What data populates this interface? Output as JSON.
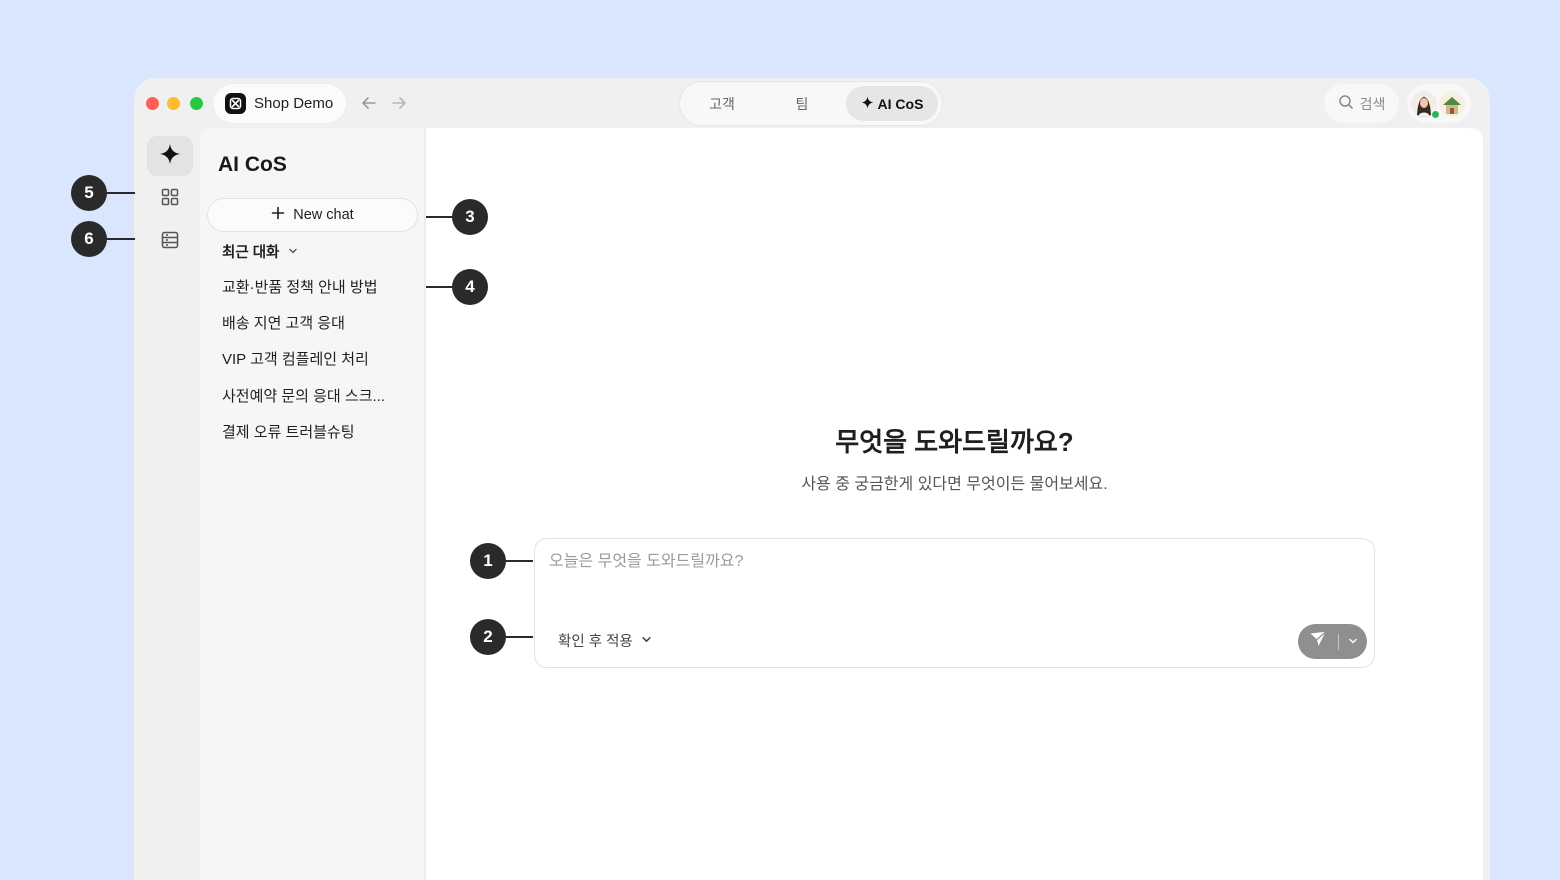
{
  "window": {
    "app_name": "Shop Demo",
    "tabs": [
      {
        "label": "고객",
        "active": false
      },
      {
        "label": "팀",
        "active": false
      },
      {
        "label": "AI CoS",
        "active": true,
        "icon": "sparkle-icon"
      }
    ],
    "search_label": "검색"
  },
  "rail": {
    "items": [
      {
        "icon": "sparkle-icon",
        "active": true
      },
      {
        "icon": "grid-icon",
        "active": false
      },
      {
        "icon": "list-icon",
        "active": false
      }
    ]
  },
  "sidebar": {
    "title": "AI CoS",
    "new_chat_label": "New chat",
    "section_label": "최근 대화",
    "chats": [
      "교환·반품 정책 안내 방법",
      "배송 지연 고객 응대",
      "VIP 고객 컴플레인 처리",
      "사전예약 문의 응대 스크...",
      "결제 오류 트러블슈팅"
    ]
  },
  "main": {
    "heading": "무엇을 도와드릴까요?",
    "subheading": "사용 중 궁금한게 있다면 무엇이든 물어보세요.",
    "input_placeholder": "오늘은 무엇을 도와드릴까요?",
    "mode_label": "확인 후 적용"
  },
  "callouts": [
    "1",
    "2",
    "3",
    "4",
    "5",
    "6"
  ],
  "colors": {
    "background": "#d9e6fd",
    "callout": "#2a2a2a",
    "send_button": "#8f8f8f",
    "online": "#2cb458"
  }
}
